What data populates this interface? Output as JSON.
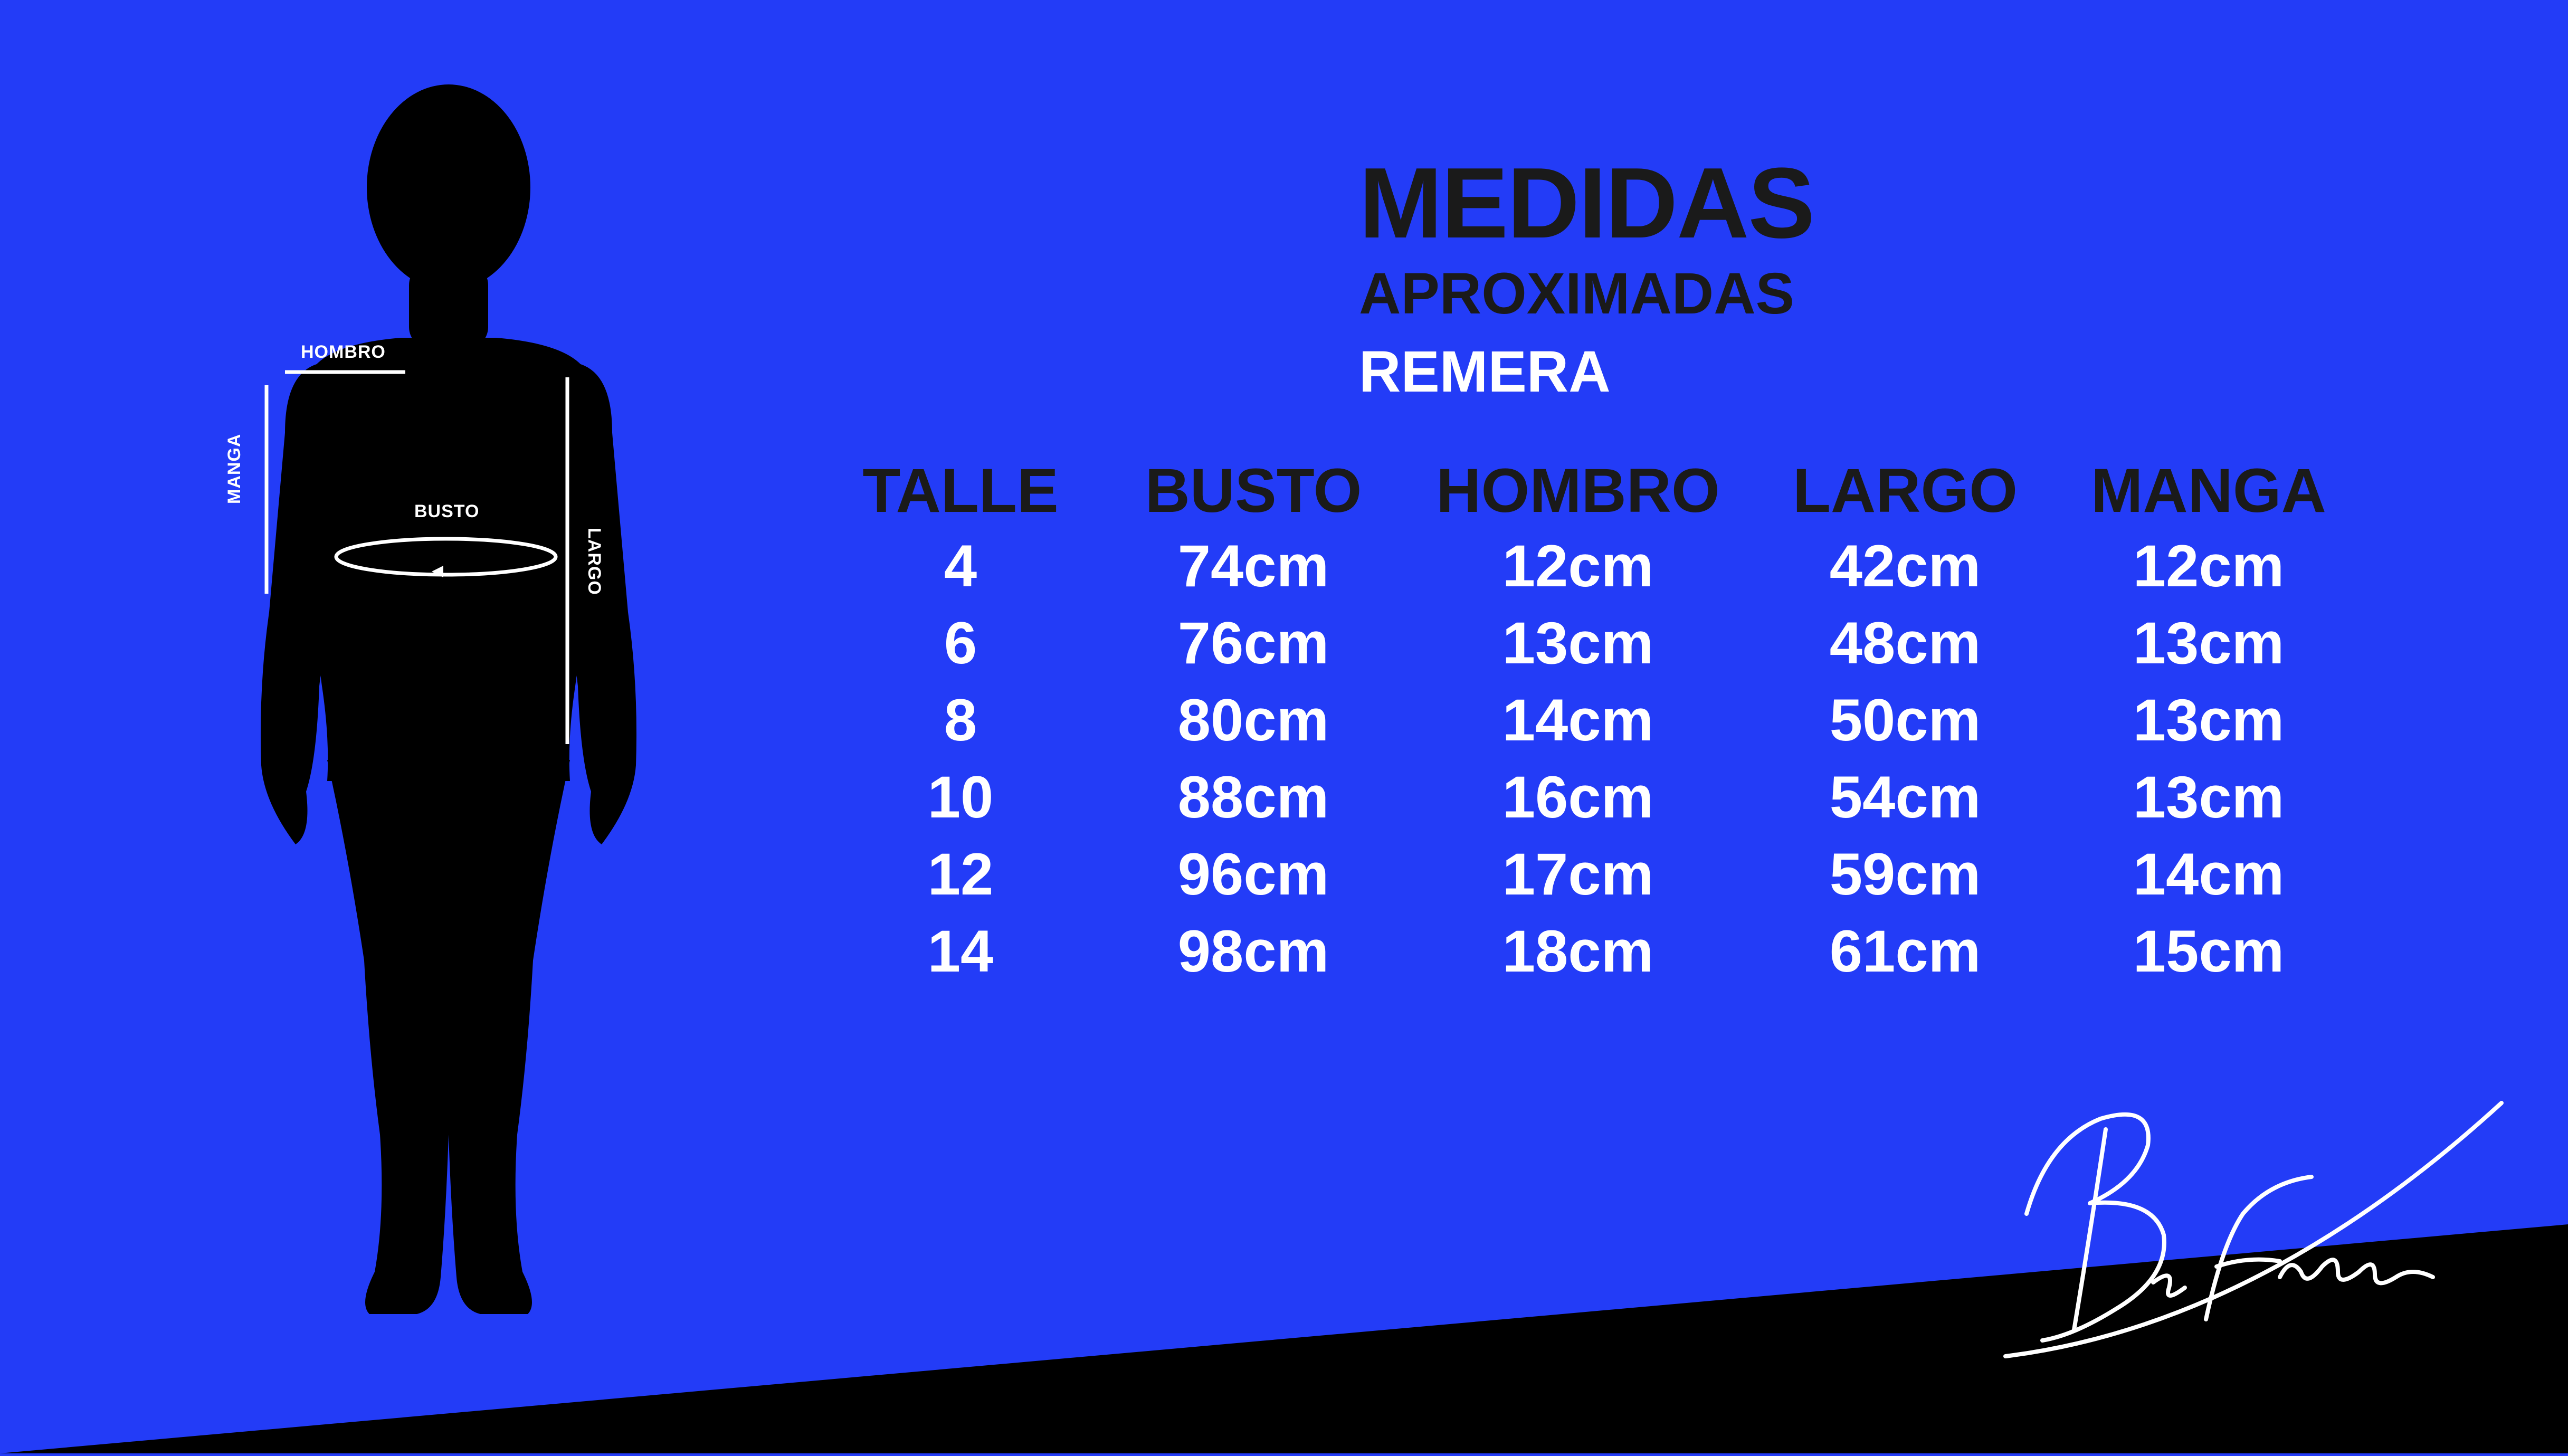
{
  "colors": {
    "background": "#233cf7",
    "band": "#000000",
    "heading": "#1a1a1a",
    "values": "#ffffff"
  },
  "figure": {
    "labels": {
      "hombro": "HOMBRO",
      "busto": "BUSTO",
      "manga": "MANGA",
      "largo": "LARGO"
    }
  },
  "title": {
    "main": "MEDIDAS",
    "sub": "APROXIMADAS",
    "product": "REMERA"
  },
  "table": {
    "headers": [
      "TALLE",
      "BUSTO",
      "HOMBRO",
      "LARGO",
      "MANGA"
    ],
    "rows": [
      [
        "4",
        "74cm",
        "12cm",
        "42cm",
        "12cm"
      ],
      [
        "6",
        "76cm",
        "13cm",
        "48cm",
        "13cm"
      ],
      [
        "8",
        "80cm",
        "14cm",
        "50cm",
        "13cm"
      ],
      [
        "10",
        "88cm",
        "16cm",
        "54cm",
        "13cm"
      ],
      [
        "12",
        "96cm",
        "17cm",
        "59cm",
        "14cm"
      ],
      [
        "14",
        "98cm",
        "18cm",
        "61cm",
        "15cm"
      ]
    ]
  },
  "brand": {
    "signature": "BeFree"
  }
}
